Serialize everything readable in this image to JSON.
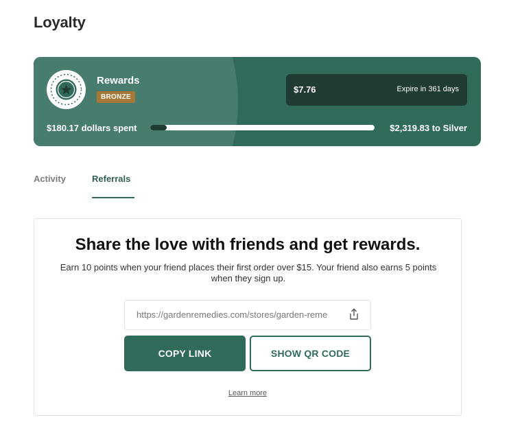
{
  "page": {
    "title": "Loyalty"
  },
  "rewards": {
    "title": "Rewards",
    "tier": "BRONZE",
    "points_value": "$7.76",
    "expire_text": "Expire in 361 days",
    "spent_text": "$180.17 dollars spent",
    "to_next_text": "$2,319.83 to Silver",
    "progress_fraction": 0.072,
    "badge_icon": "star-medal-icon",
    "colors": {
      "card": "#2f6a5a",
      "card_highlight": "#477c6e",
      "points_box": "#1f3b33",
      "tier_badge": "#a67735"
    }
  },
  "tabs": [
    {
      "label": "Activity",
      "active": false
    },
    {
      "label": "Referrals",
      "active": true
    }
  ],
  "referral": {
    "heading": "Share the love with friends and get rewards.",
    "description": "Earn 10 points when your friend places their first order over $15. Your friend also earns 5 points when they sign up.",
    "link_value": "https://gardenremedies.com/stores/garden-reme",
    "share_icon": "share-icon",
    "copy_label": "COPY LINK",
    "qr_label": "SHOW QR CODE",
    "learn_more": "Learn more"
  }
}
